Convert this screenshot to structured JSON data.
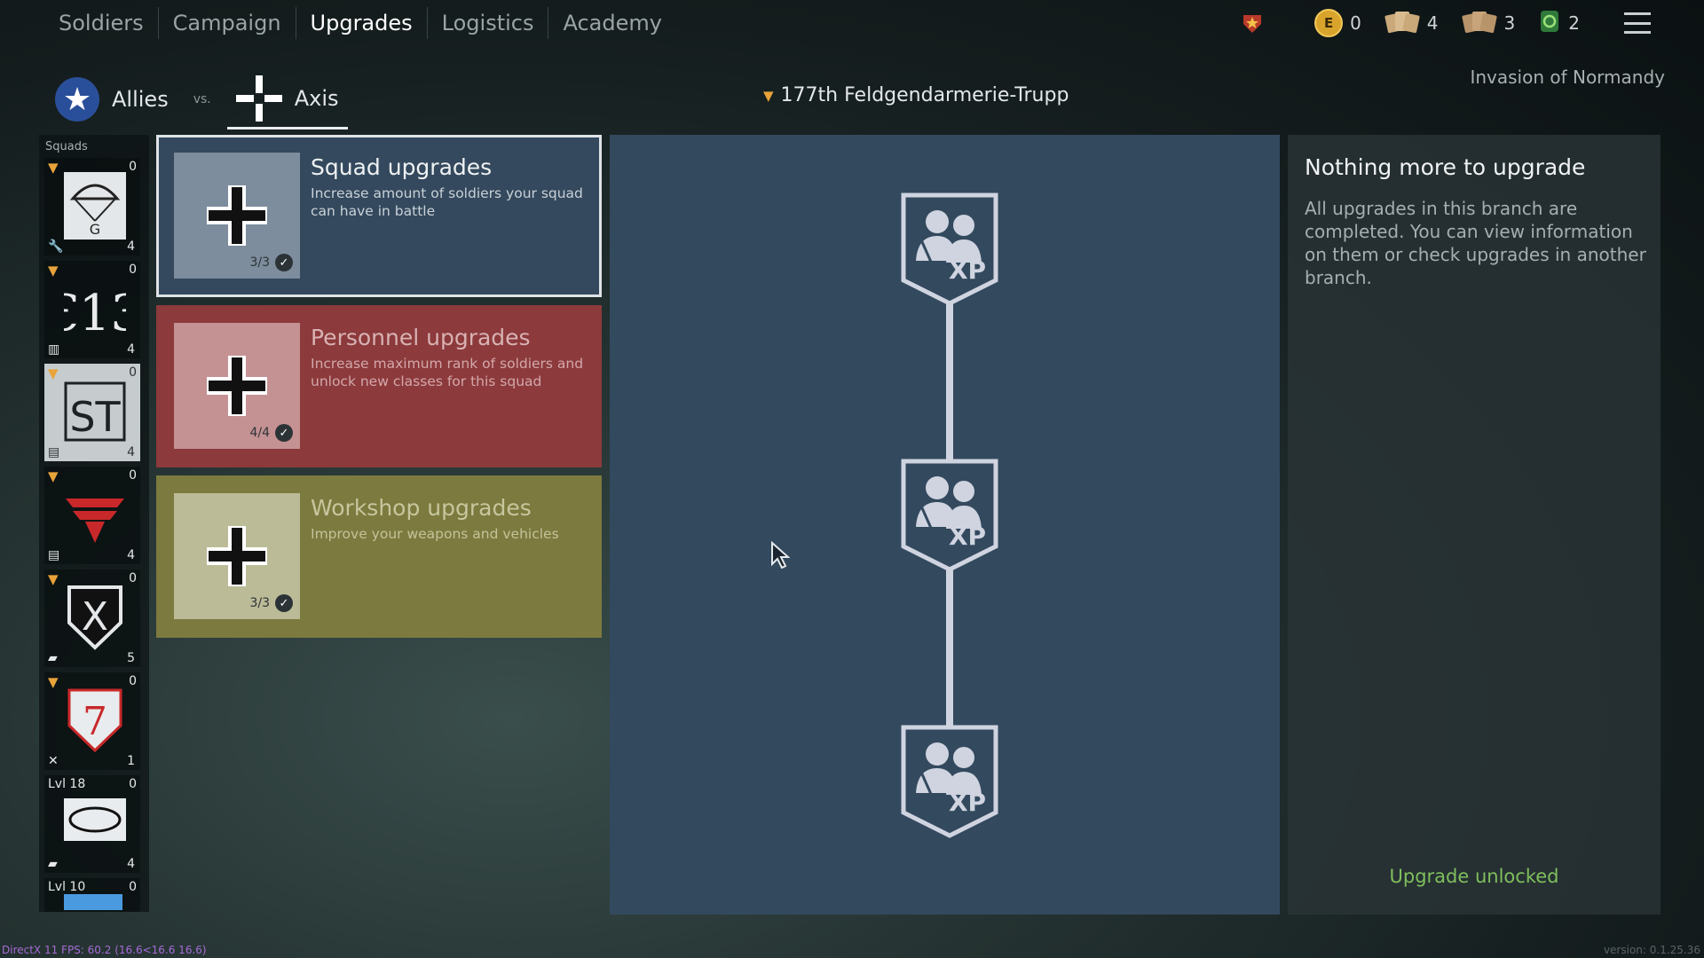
{
  "nav": {
    "tabs": [
      {
        "label": "Soldiers",
        "active": false
      },
      {
        "label": "Campaign",
        "active": false
      },
      {
        "label": "Upgrades",
        "active": true
      },
      {
        "label": "Logistics",
        "active": false
      },
      {
        "label": "Academy",
        "active": false
      }
    ]
  },
  "currencies": {
    "enlisted_coins": "0",
    "weapon_orders": "4",
    "soldier_orders": "3",
    "exp_boosters": "2"
  },
  "factions": {
    "allies": "Allies",
    "vs": "vs.",
    "axis": "Axis"
  },
  "squad_title": "177th Feldgendarmerie-Trupp",
  "campaign_name": "Invasion of Normandy",
  "sidebar": {
    "title": "Squads",
    "squads": [
      {
        "top_left": "",
        "top_right": "0",
        "bottom": "4",
        "emblem": "paratrooper-icon",
        "class_icon": "engineer-icon"
      },
      {
        "top_left": "",
        "top_right": "0",
        "bottom": "4",
        "emblem": "e13-emblem-icon",
        "class_icon": "mortar-icon"
      },
      {
        "top_left": "",
        "top_right": "0",
        "bottom": "4",
        "emblem": "st-emblem-icon",
        "class_icon": "radio-icon"
      },
      {
        "top_left": "",
        "top_right": "0",
        "bottom": "4",
        "emblem": "red-wings-emblem-icon",
        "class_icon": "radio-icon"
      },
      {
        "top_left": "",
        "top_right": "0",
        "bottom": "5",
        "emblem": "x-shield-emblem-icon",
        "class_icon": "tank-icon"
      },
      {
        "top_left": "",
        "top_right": "0",
        "bottom": "1",
        "emblem": "seven-shield-emblem-icon",
        "class_icon": "melee-icon"
      },
      {
        "top_left": "Lvl 18",
        "top_right": "0",
        "bottom": "4",
        "emblem": "oval-emblem-icon",
        "class_icon": "tank-icon"
      },
      {
        "top_left": "Lvl 10",
        "top_right": "0",
        "bottom": "",
        "emblem": "blue-emblem-icon",
        "class_icon": ""
      }
    ]
  },
  "branches": [
    {
      "title": "Squad upgrades",
      "desc": "Increase amount of soldiers your squad can have in battle",
      "count": "3/3"
    },
    {
      "title": "Personnel upgrades",
      "desc": "Increase maximum rank of soldiers and unlock new classes for this squad",
      "count": "4/4"
    },
    {
      "title": "Workshop upgrades",
      "desc": "Improve your weapons and vehicles",
      "count": "3/3"
    }
  ],
  "tree": {
    "nodes": [
      {
        "label": "XP",
        "icon": "squad-xp-icon"
      },
      {
        "label": "XP",
        "icon": "squad-xp-icon"
      },
      {
        "label": "XP",
        "icon": "squad-xp-icon"
      }
    ]
  },
  "info": {
    "title": "Nothing more to upgrade",
    "desc": "All upgrades in this branch are completed. You can view information on them or check upgrades in another branch.",
    "status": "Upgrade unlocked"
  },
  "debug": {
    "fps": "DirectX 11 FPS: 60.2 (16.6<16.6 16.6)",
    "version": "version: 0.1.25.36"
  },
  "colors": {
    "tree_bg": "#33495e",
    "squad_branch": "#34495d",
    "personnel_branch": "#8c3a3c",
    "workshop_branch": "#7c7a3e",
    "unlocked_text": "#7fbf5d"
  }
}
